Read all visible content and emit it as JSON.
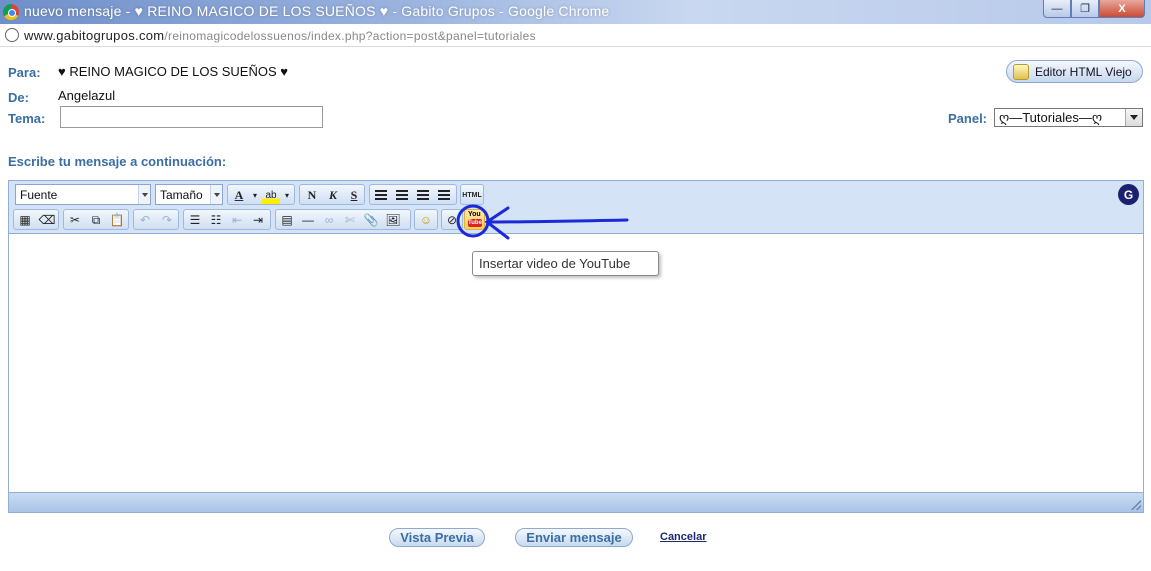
{
  "window": {
    "title": "nuevo mensaje - ♥ REINO MAGICO DE LOS SUEÑOS ♥ - Gabito Grupos - Google Chrome",
    "url_host": "www.gabitogrupos.com",
    "url_path": "/reinomagicodelossuenos/index.php?action=post&panel=tutoriales",
    "controls": {
      "minimize": "—",
      "restore": "❐",
      "close": "X"
    }
  },
  "form": {
    "para_label": "Para:",
    "para_value": "♥ REINO MAGICO DE LOS SUEÑOS ♥",
    "de_label": "De:",
    "de_value": "Angelazul",
    "tema_label": "Tema:",
    "tema_value": "",
    "editor_old_label": "Editor HTML Viejo",
    "panel_label": "Panel:",
    "panel_value": "ღ—Tutoriales—ღ",
    "compose_label": "Escribe tu mensaje a continuación:"
  },
  "toolbar": {
    "font_value": "Fuente",
    "size_value": "Tamaño",
    "bold": "N",
    "italic": "K",
    "underline": "S",
    "html_label": "HTML",
    "g_badge": "G",
    "youtube_you": "You",
    "youtube_tube": "Tube",
    "tooltip": "Insertar video de YouTube"
  },
  "actions": {
    "preview": "Vista Previa",
    "send": "Enviar mensaje",
    "cancel": "Cancelar"
  },
  "colors": {
    "label_blue": "#3a6ea5",
    "toolbar_bg": "#d4e3f5",
    "annotation_blue": "#1a2ad8"
  }
}
